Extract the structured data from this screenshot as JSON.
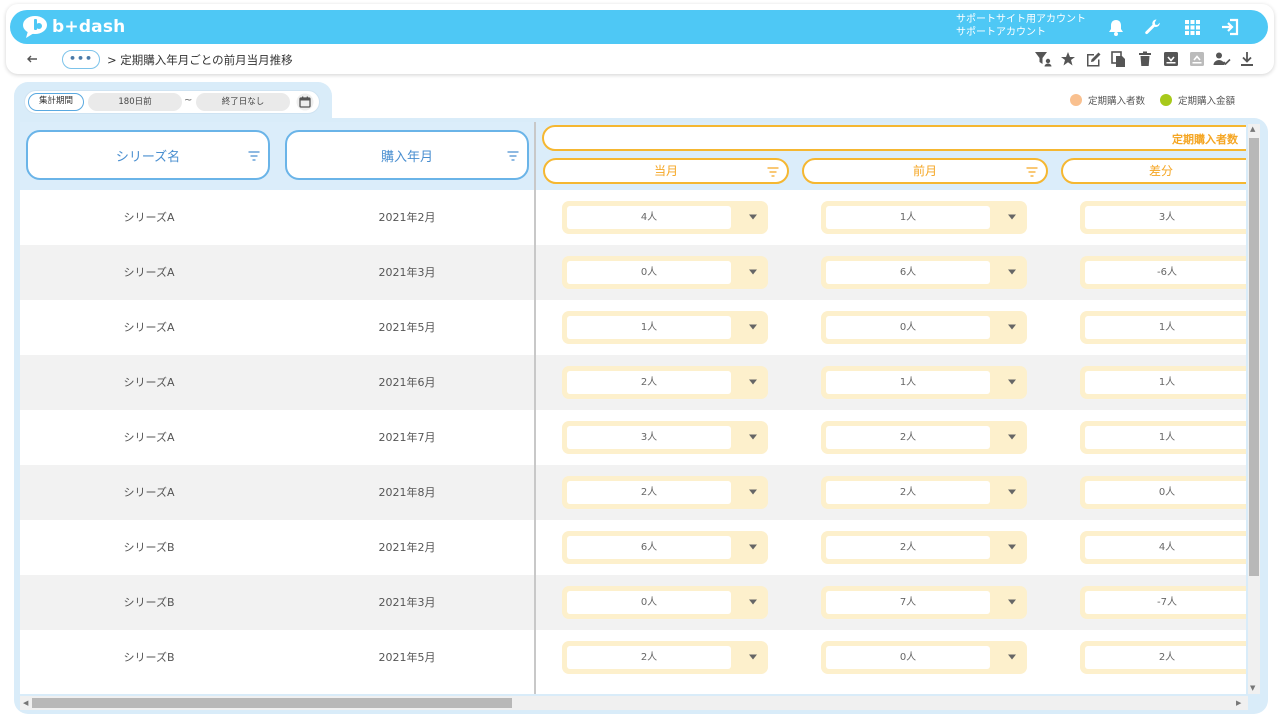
{
  "app": {
    "logo_text": "b+dash",
    "account_line1": "サポートサイト用アカウント",
    "account_line2": "サポートアカウント"
  },
  "breadcrumb": {
    "more_label": "•••",
    "separator": ">",
    "title": "定期購入年月ごとの前月当月推移"
  },
  "filter": {
    "period_label": "集計期間",
    "from_value": "180日前",
    "tilde": "~",
    "to_value": "終了日なし"
  },
  "legend": [
    {
      "label": "定期購入者数",
      "color": "#f9c08f"
    },
    {
      "label": "定期購入金額",
      "color": "#a7c91a"
    }
  ],
  "table": {
    "col_series": "シリーズ名",
    "col_month": "購入年月",
    "group_label": "定期購入者数",
    "sub_current": "当月",
    "sub_prev": "前月",
    "sub_diff": "差分",
    "rows": [
      {
        "series": "シリーズA",
        "month": "2021年2月",
        "current": "4人",
        "prev": "1人",
        "diff": "3人"
      },
      {
        "series": "シリーズA",
        "month": "2021年3月",
        "current": "0人",
        "prev": "6人",
        "diff": "-6人"
      },
      {
        "series": "シリーズA",
        "month": "2021年5月",
        "current": "1人",
        "prev": "0人",
        "diff": "1人"
      },
      {
        "series": "シリーズA",
        "month": "2021年6月",
        "current": "2人",
        "prev": "1人",
        "diff": "1人"
      },
      {
        "series": "シリーズA",
        "month": "2021年7月",
        "current": "3人",
        "prev": "2人",
        "diff": "1人"
      },
      {
        "series": "シリーズA",
        "month": "2021年8月",
        "current": "2人",
        "prev": "2人",
        "diff": "0人"
      },
      {
        "series": "シリーズB",
        "month": "2021年2月",
        "current": "6人",
        "prev": "2人",
        "diff": "4人"
      },
      {
        "series": "シリーズB",
        "month": "2021年3月",
        "current": "0人",
        "prev": "7人",
        "diff": "-7人"
      },
      {
        "series": "シリーズB",
        "month": "2021年5月",
        "current": "2人",
        "prev": "0人",
        "diff": "2人"
      }
    ]
  },
  "colors": {
    "brand": "#4ec8f5",
    "accent_orange": "#f5b731",
    "header_blue": "#6ab4e8"
  },
  "icons": [
    "bell-icon",
    "wrench-icon",
    "grid-icon",
    "logout-icon",
    "back-arrow-icon",
    "filter-person-icon",
    "star-icon",
    "edit-icon",
    "copy-icon",
    "trash-icon",
    "archive-icon",
    "unarchive-icon",
    "user-check-icon",
    "download-icon",
    "calendar-icon",
    "filter-icon",
    "caret-down-icon"
  ]
}
